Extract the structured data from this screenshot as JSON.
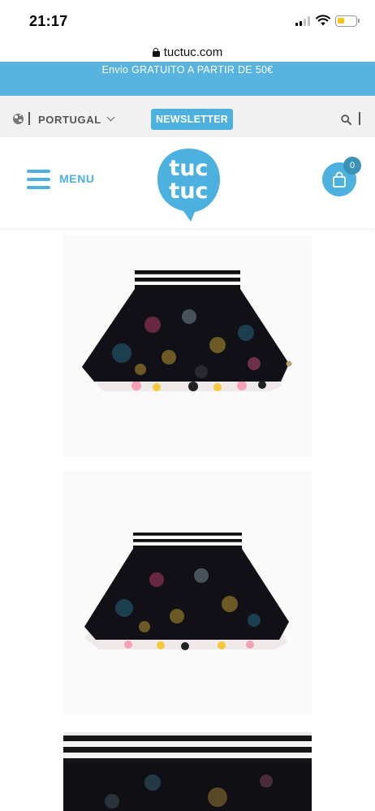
{
  "status_bar": {
    "time": "21:17"
  },
  "browser": {
    "url": "tuctuc.com"
  },
  "promo": {
    "text": "Envio GRATUITO A PARTIR DE 50€"
  },
  "toolbar": {
    "country": "PORTUGAL",
    "newsletter_label": "NEWSLETTER",
    "icons": [
      "globe-icon",
      "chevron-down-icon",
      "search-icon"
    ]
  },
  "header": {
    "menu_label": "MENU",
    "logo_line1": "tuc",
    "logo_line2": "tuc",
    "cart_count": "0",
    "icons": [
      "hamburger-icon",
      "shopping-bag-icon"
    ]
  },
  "colors": {
    "brand": "#4db1df",
    "promo_bg": "#58b3df",
    "toolbar_bg": "#f1f1f1",
    "badge": "#3a93b7"
  },
  "gallery": {
    "images": [
      "product-photo-skirt-front",
      "product-photo-skirt-back",
      "product-photo-skirt-detail"
    ]
  }
}
